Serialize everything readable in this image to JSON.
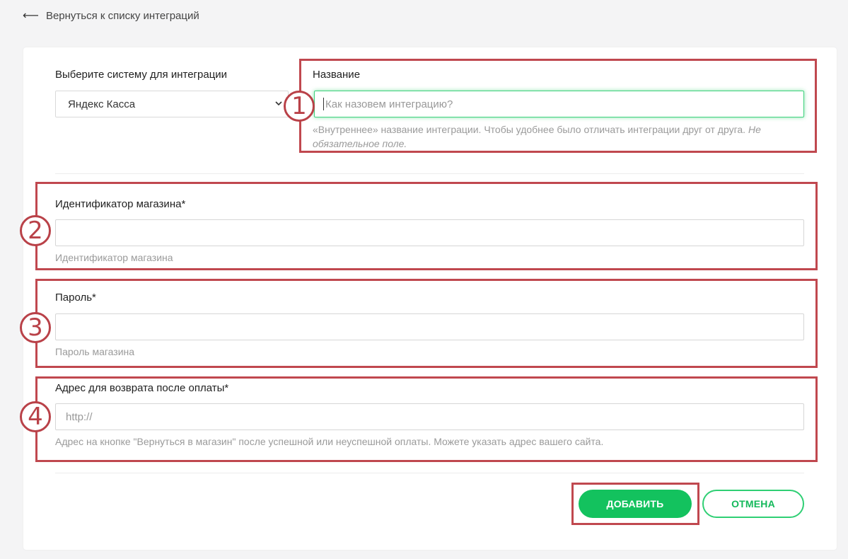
{
  "back_link": {
    "label": "Вернуться к списку интеграций"
  },
  "form": {
    "system": {
      "label": "Выберите систему для интеграции",
      "selected": "Яндекс Касса"
    },
    "name": {
      "label": "Название",
      "placeholder": "Как назовем интеграцию?",
      "hint": "«Внутреннее» название интеграции. Чтобы удобнее было отличать интеграции друг от друга.",
      "hint_optional": "Не обязательное поле."
    },
    "shop_id": {
      "label": "Идентификатор магазина*",
      "value": "",
      "hint": "Идентификатор магазина"
    },
    "password": {
      "label": "Пароль*",
      "value": "",
      "hint": "Пароль магазина"
    },
    "return_url": {
      "label": "Адрес для возврата после оплаты*",
      "placeholder": "http://",
      "hint": "Адрес на кнопке \"Вернуться в магазин\" после успешной или неуспешной оплаты. Можете указать адрес вашего сайта."
    }
  },
  "buttons": {
    "add": "ДОБАВИТЬ",
    "cancel": "ОТМЕНА"
  },
  "annotations": [
    "1",
    "2",
    "3",
    "4"
  ],
  "colors": {
    "accent": "#13c25e",
    "annotation": "#c0484f",
    "focus_glow": "#3fd27d"
  }
}
